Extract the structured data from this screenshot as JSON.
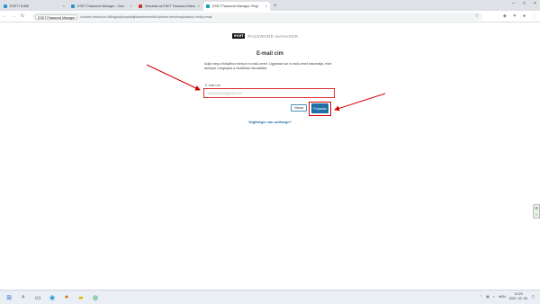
{
  "browser": {
    "tabs": [
      {
        "title": "ESET HOME",
        "color": "#2b8fd1",
        "active": false
      },
      {
        "title": "ESET Password Manager - Chro",
        "color": "#2b8fd1",
        "active": false
      },
      {
        "title": "Útmutató az ESET Password Mana",
        "color": "#c0392b",
        "active": false
      },
      {
        "title": "ESET Password Manager: Regi",
        "color": "#14a0b0",
        "active": true
      }
    ],
    "new_tab": "+",
    "address_chip": "ESET Password Manager",
    "url": "chrome-extension://iiihdgkejbbopeiddjhdaeelmneefkk/ui/index.html#/registration-verify-email"
  },
  "logo": {
    "brand": "eset",
    "product": "PASSWORD MANAGER"
  },
  "page": {
    "title": "E-mail cím",
    "description": "Adja meg a fiókjához tartozó e-mail-címet. Ugyanazt az e-mail-címet használja, mint amelyre megkapta a beállítási útmutatást.",
    "email_label": "E-mail cím",
    "email_value": "felhasznalo@gmail.com",
    "back_button": "Vissza",
    "next_button": "Folytatás",
    "help_link": "Segítségre van szüksége?"
  },
  "taskbar": {
    "language": "HUN",
    "time": "10:23",
    "date": "2021. 02. 05."
  },
  "colors": {
    "accent": "#1e6fa5",
    "highlight": "#d40000"
  }
}
